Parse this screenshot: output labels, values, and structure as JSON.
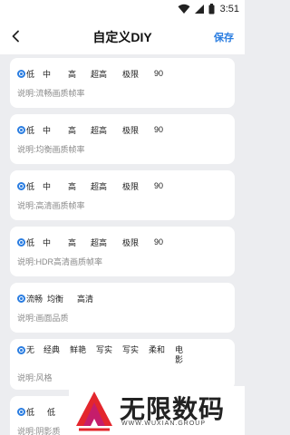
{
  "status_bar": {
    "time": "3:51"
  },
  "header": {
    "title": "自定义DIY",
    "save_label": "保存"
  },
  "cards": [
    {
      "options": [
        "低",
        "中",
        "高",
        "超高",
        "极限",
        "90"
      ],
      "selected": 0,
      "description": "说明:流畅画质帧率"
    },
    {
      "options": [
        "低",
        "中",
        "高",
        "超高",
        "极限",
        "90"
      ],
      "selected": 0,
      "description": "说明:均衡画质帧率"
    },
    {
      "options": [
        "低",
        "中",
        "高",
        "超高",
        "极限",
        "90"
      ],
      "selected": 0,
      "description": "说明:高清画质帧率"
    },
    {
      "options": [
        "低",
        "中",
        "高",
        "超高",
        "极限",
        "90"
      ],
      "selected": 0,
      "description": "说明:HDR高清画质帧率"
    },
    {
      "options": [
        "流畅",
        "均衡",
        "高清"
      ],
      "selected": 0,
      "description": "说明:画面品质"
    },
    {
      "options": [
        "无",
        "经典",
        "鲜艳",
        "写实",
        "写实",
        "柔和",
        "电影"
      ],
      "selected": 0,
      "description": "说明:风格"
    },
    {
      "options": [
        "低",
        "低"
      ],
      "selected": 0,
      "description": "说明:阴影质"
    }
  ],
  "watermark": {
    "brand": "无限数码",
    "site": "WWW.WUXIAN.GROUP"
  },
  "colors": {
    "accent": "#2a7de1",
    "background": "#ecedf0",
    "card": "#ffffff"
  }
}
